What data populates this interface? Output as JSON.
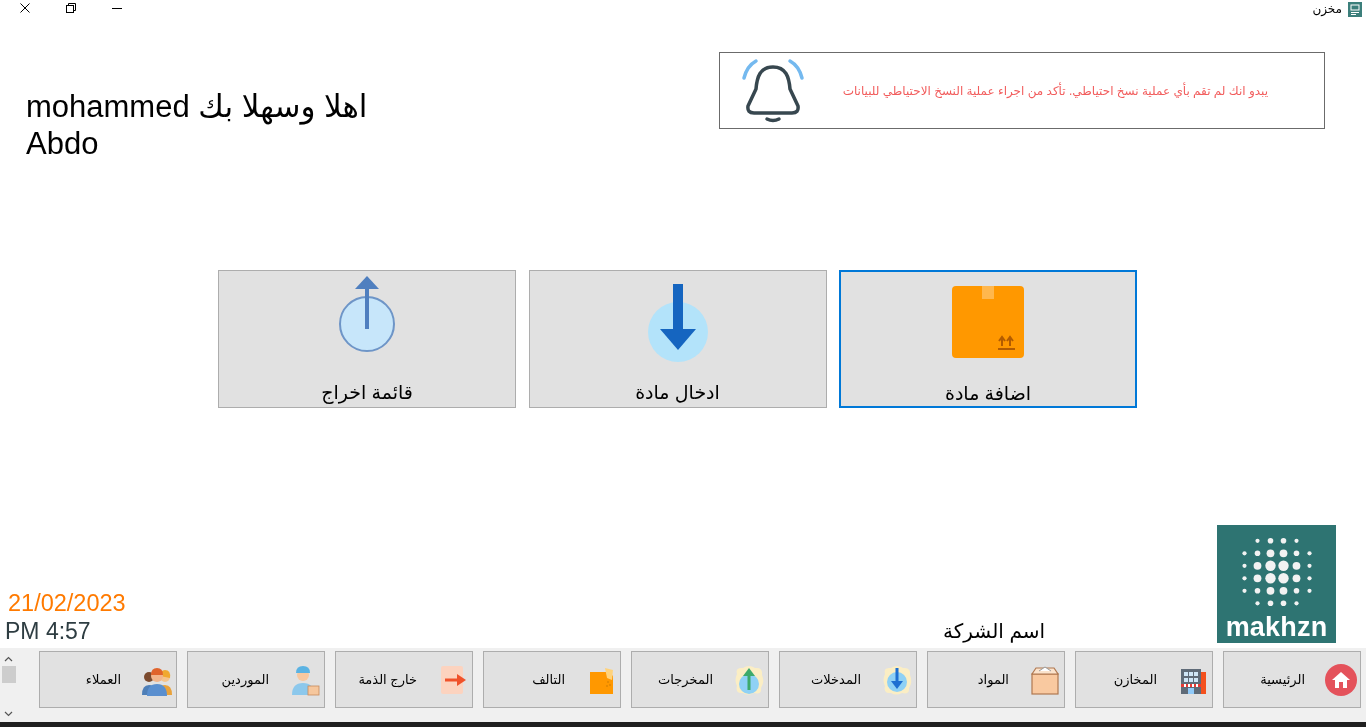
{
  "window": {
    "title": "مخزن"
  },
  "notification": {
    "message": "يبدو انك لم تقم بأي عملية نسخ احتياطي. تأكد من اجراء عملية النسخ الاحتياطي للبيانات"
  },
  "greeting": "اهلا وسهلا بك mohammed Abdo",
  "actions": [
    {
      "label": "اضافة مادة",
      "selected": true
    },
    {
      "label": "ادخال مادة",
      "selected": false
    },
    {
      "label": "قائمة اخراج",
      "selected": false
    }
  ],
  "date": "21/02/2023",
  "time": "PM 4:57",
  "company_name": "اسم الشركة",
  "logo": {
    "text": "makhzn"
  },
  "nav_buttons": [
    {
      "label": "الرئيسية"
    },
    {
      "label": "المخازن"
    },
    {
      "label": "المواد"
    },
    {
      "label": "المدخلات"
    },
    {
      "label": "المخرجات"
    },
    {
      "label": "التالف"
    },
    {
      "label": "خارج الذمة"
    },
    {
      "label": "الموردين"
    },
    {
      "label": "العملاء"
    }
  ]
}
